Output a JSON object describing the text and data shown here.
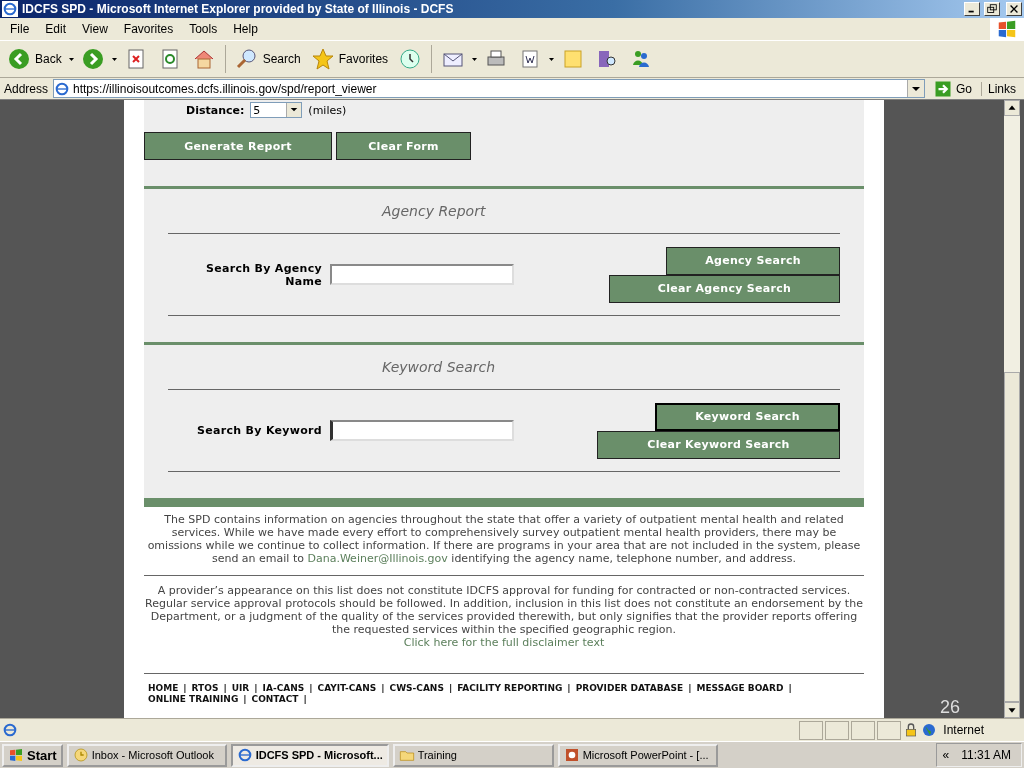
{
  "window": {
    "title": "IDCFS SPD - Microsoft Internet Explorer provided by State of Illinois - DCFS"
  },
  "menu": [
    "File",
    "Edit",
    "View",
    "Favorites",
    "Tools",
    "Help"
  ],
  "toolbar": [
    {
      "kind": "back",
      "label": "Back"
    },
    {
      "kind": "forward"
    },
    {
      "kind": "stop"
    },
    {
      "kind": "refresh"
    },
    {
      "kind": "home"
    },
    {
      "kind": "search",
      "label": "Search"
    },
    {
      "kind": "favorites",
      "label": "Favorites"
    },
    {
      "kind": "history"
    },
    {
      "kind": "mail"
    },
    {
      "kind": "print"
    },
    {
      "kind": "edit"
    },
    {
      "kind": "discuss"
    },
    {
      "kind": "research"
    },
    {
      "kind": "messenger"
    }
  ],
  "address_bar": {
    "label": "Address",
    "url": "https://illinoisoutcomes.dcfs.illinois.gov/spd/report_viewer",
    "go": "Go",
    "links": "Links"
  },
  "distance": {
    "label": "Distance:",
    "value": "5",
    "unit": "(miles)"
  },
  "form_buttons": [
    "Generate Report",
    "Clear Form"
  ],
  "sections": [
    {
      "title": "Agency Report",
      "field_label": "Search By Agency Name",
      "focused": false,
      "buttons": [
        {
          "label": "Agency Search",
          "focused": false
        },
        {
          "label": "Clear Agency Search",
          "focused": false
        }
      ]
    },
    {
      "title": "Keyword Search",
      "field_label": "Search By Keyword",
      "focused": true,
      "buttons": [
        {
          "label": "Keyword Search",
          "focused": true
        },
        {
          "label": "Clear Keyword Search",
          "focused": false
        }
      ]
    }
  ],
  "info_text": {
    "before": "The SPD contains information on agencies throughout the state that offer a variety of outpatient mental health and related services. While we have made every effort to comprehensively survey outpatient mental health providers, there may be omissions while we continue to collect information. If there are programs in your area that are not included in the system, please send an email to",
    "email": "Dana.Weiner@Illinois.gov",
    "after": "identifying the agency name, telephone number, and address."
  },
  "disclaimer": {
    "text": "A provider’s appearance on this list does not constitute IDCFS approval for funding for contracted or non-contracted services. Regular service approval protocols should be followed. In addition, inclusion in this list does not constitute an endorsement by the Department, or a judgment of the quality of the services provided therewith, but only signifies that the provider reports offering the requested services within the specified geographic region.",
    "link": "Click here for the full disclaimer text"
  },
  "footer_nav": [
    {
      "label": "HOME",
      "separator": "|"
    },
    {
      "label": "RTOS",
      "separator": "|"
    },
    {
      "label": "UIR",
      "separator": "|"
    },
    {
      "label": "IA-CANS",
      "separator": "|"
    },
    {
      "label": "CAYIT-CANS",
      "separator": "|"
    },
    {
      "label": "CWS-CANS",
      "separator": "|"
    },
    {
      "label": "FACILITY REPORTING",
      "separator": "|"
    },
    {
      "label": "PROVIDER DATABASE",
      "separator": "|"
    },
    {
      "label": "MESSAGE BOARD",
      "separator": "|"
    },
    {
      "label": "ONLINE TRAINING",
      "separator": "|"
    },
    {
      "label": "CONTACT",
      "separator": "|"
    }
  ],
  "status_bar": {
    "zone": "Internet"
  },
  "slide_number": "26",
  "taskbar": {
    "start": "Start",
    "tasks": [
      {
        "kind": "outlook",
        "label": "Inbox - Microsoft Outlook",
        "selected": false
      },
      {
        "kind": "ie",
        "label": "IDCFS SPD - Microsoft...",
        "selected": true
      },
      {
        "kind": "folder",
        "label": "Training",
        "selected": false
      },
      {
        "kind": "powerpoint",
        "label": "Microsoft PowerPoint - [...",
        "selected": false
      }
    ],
    "expand": "«",
    "time": "11:31 AM"
  }
}
